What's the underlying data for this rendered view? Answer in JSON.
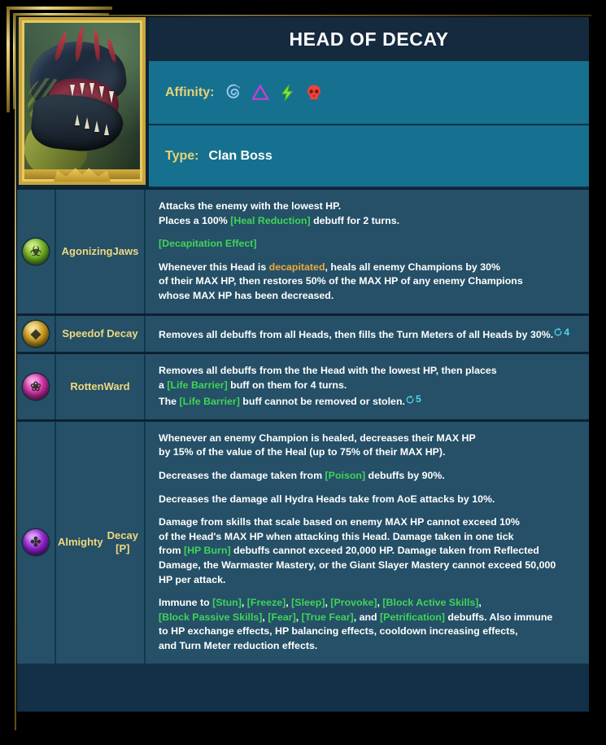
{
  "card": {
    "title": "HEAD OF DECAY",
    "portrait_name": "hydra-head-portrait"
  },
  "info": {
    "affinity_label": "Affinity:",
    "affinity_icons": [
      {
        "name": "affinity-spirit-icon",
        "color": "#7fb3ea"
      },
      {
        "name": "affinity-magic-icon",
        "color": "#c23fd8"
      },
      {
        "name": "affinity-force-icon",
        "color": "#7ce53a"
      },
      {
        "name": "affinity-void-icon",
        "color": "#e8443c"
      }
    ],
    "type_label": "Type:",
    "type_value": "Clan Boss"
  },
  "skills": [
    {
      "icon_name": "agonizing-jaws-icon",
      "icon_style": "orb-green",
      "name_line1": "Agonizing",
      "name_line2": "Jaws",
      "paragraphs": [
        [
          {
            "t": "Attacks the enemy with the lowest HP.",
            "c": "w"
          },
          {
            "t": "BR"
          },
          {
            "t": "Places a 100% ",
            "c": "w"
          },
          {
            "t": "[Heal Reduction]",
            "c": "grn"
          },
          {
            "t": " debuff for 2 turns.",
            "c": "w"
          }
        ],
        [
          {
            "t": "[Decapitation Effect]",
            "c": "grn"
          }
        ],
        [
          {
            "t": "Whenever this Head is ",
            "c": "w"
          },
          {
            "t": "decapitated",
            "c": "org"
          },
          {
            "t": ", heals all enemy Champions by 30%",
            "c": "w"
          },
          {
            "t": "BR"
          },
          {
            "t": "of their MAX HP, then restores 50% of the MAX HP of any enemy Champions",
            "c": "w"
          },
          {
            "t": "BR"
          },
          {
            "t": "whose MAX HP has been decreased.",
            "c": "w"
          }
        ]
      ]
    },
    {
      "icon_name": "speed-of-decay-icon",
      "icon_style": "orb-gold",
      "name_line1": "Speed",
      "name_line2": "of Decay",
      "paragraphs": [
        [
          {
            "t": "Removes all debuffs from all Heads, then fills the Turn Meters of all Heads by 30%.",
            "c": "w"
          },
          {
            "t": "CD",
            "v": "4"
          }
        ]
      ]
    },
    {
      "icon_name": "rotten-ward-icon",
      "icon_style": "orb-pink",
      "name_line1": "Rotten",
      "name_line2": "Ward",
      "paragraphs": [
        [
          {
            "t": "Removes all debuffs from the the Head with the lowest HP, then places",
            "c": "w"
          },
          {
            "t": "BR"
          },
          {
            "t": "a ",
            "c": "w"
          },
          {
            "t": "[Life Barrier]",
            "c": "grn"
          },
          {
            "t": " buff on them for 4 turns.",
            "c": "w"
          },
          {
            "t": "BR"
          },
          {
            "t": "The ",
            "c": "w"
          },
          {
            "t": "[Life Barrier]",
            "c": "grn"
          },
          {
            "t": " buff cannot be removed or stolen.",
            "c": "w"
          },
          {
            "t": "CD",
            "v": "5"
          }
        ]
      ]
    },
    {
      "icon_name": "almighty-decay-icon",
      "icon_style": "orb-purp",
      "name_line1": "Almighty",
      "name_line2": "Decay [P]",
      "paragraphs": [
        [
          {
            "t": "Whenever an enemy Champion is healed, decreases their MAX HP",
            "c": "w"
          },
          {
            "t": "BR"
          },
          {
            "t": "by 15% of the value of the Heal (up to 75% of their MAX HP).",
            "c": "w"
          }
        ],
        [
          {
            "t": "Decreases the damage taken from ",
            "c": "w"
          },
          {
            "t": "[Poison]",
            "c": "grn"
          },
          {
            "t": " debuffs by 90%.",
            "c": "w"
          }
        ],
        [
          {
            "t": "Decreases the damage all Hydra Heads take from AoE attacks by 10%.",
            "c": "w"
          }
        ],
        [
          {
            "t": "Damage from skills that scale based on enemy MAX HP cannot exceed 10%",
            "c": "w"
          },
          {
            "t": "BR"
          },
          {
            "t": "of the Head's MAX HP when attacking this Head. Damage taken in one tick",
            "c": "w"
          },
          {
            "t": "BR"
          },
          {
            "t": "from ",
            "c": "w"
          },
          {
            "t": "[HP Burn]",
            "c": "grn"
          },
          {
            "t": " debuffs cannot exceed 20,000 HP. Damage taken from Reflected",
            "c": "w"
          },
          {
            "t": "BR"
          },
          {
            "t": "Damage, the Warmaster Mastery, or the Giant Slayer Mastery cannot exceed 50,000",
            "c": "w"
          },
          {
            "t": "BR"
          },
          {
            "t": "HP per attack.",
            "c": "w"
          }
        ],
        [
          {
            "t": "Immune to ",
            "c": "w"
          },
          {
            "t": "[Stun]",
            "c": "grn"
          },
          {
            "t": ", ",
            "c": "w"
          },
          {
            "t": "[Freeze]",
            "c": "grn"
          },
          {
            "t": ", ",
            "c": "w"
          },
          {
            "t": "[Sleep]",
            "c": "grn"
          },
          {
            "t": ", ",
            "c": "w"
          },
          {
            "t": "[Provoke]",
            "c": "grn"
          },
          {
            "t": ", ",
            "c": "w"
          },
          {
            "t": "[Block Active Skills]",
            "c": "grn"
          },
          {
            "t": ",",
            "c": "w"
          },
          {
            "t": "BR"
          },
          {
            "t": "[Block Passive Skills]",
            "c": "grn"
          },
          {
            "t": ", ",
            "c": "w"
          },
          {
            "t": "[Fear]",
            "c": "grn"
          },
          {
            "t": ", ",
            "c": "w"
          },
          {
            "t": "[True Fear]",
            "c": "grn"
          },
          {
            "t": ", and ",
            "c": "w"
          },
          {
            "t": "[Petrification]",
            "c": "grn"
          },
          {
            "t": " debuffs. Also immune",
            "c": "w"
          },
          {
            "t": "BR"
          },
          {
            "t": "to HP exchange effects, HP balancing effects, cooldown increasing effects,",
            "c": "w"
          },
          {
            "t": "BR"
          },
          {
            "t": "and Turn Meter reduction effects.",
            "c": "w"
          }
        ]
      ]
    }
  ],
  "colors": {
    "frame_gold": "#d4b84e",
    "card_bg": "#123047",
    "title_bar": "#152a3e",
    "info_bar": "#15718f",
    "skill_cell": "#255067",
    "gold_text": "#e8d274",
    "green_text": "#3fd557",
    "orange_text": "#f0a93a",
    "cyan_text": "#4fd4e8"
  }
}
